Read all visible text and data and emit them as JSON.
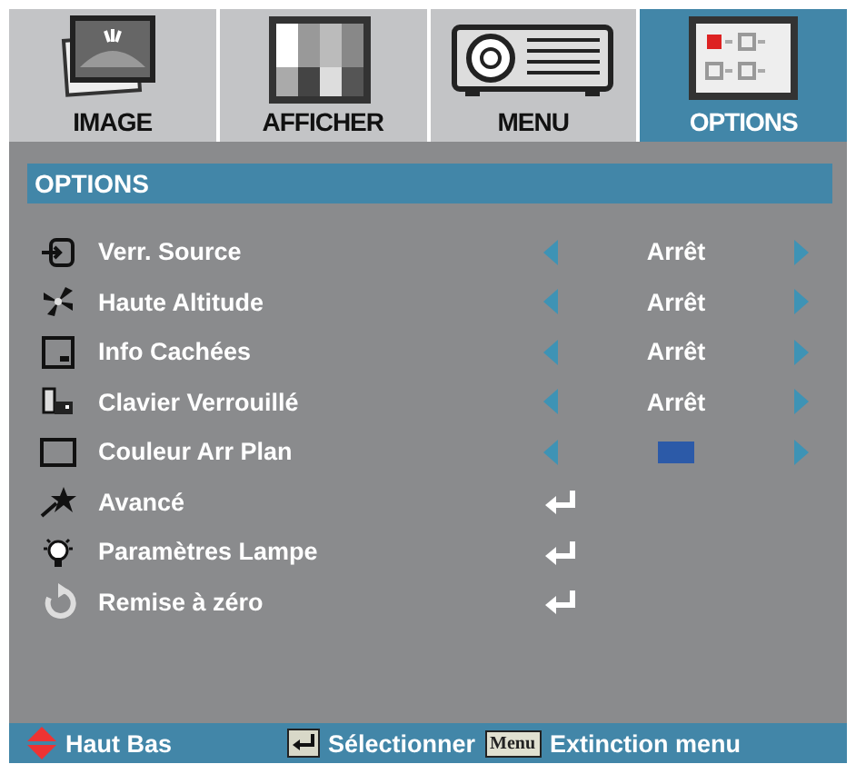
{
  "tabs": [
    {
      "label": "IMAGE",
      "selected": false
    },
    {
      "label": "AFFICHER",
      "selected": false
    },
    {
      "label": "MENU",
      "selected": false
    },
    {
      "label": "OPTIONS",
      "selected": true
    }
  ],
  "section_title": "OPTIONS",
  "rows": [
    {
      "kind": "option",
      "label": "Verr. Source",
      "value": "Arrêt"
    },
    {
      "kind": "option",
      "label": "Haute Altitude",
      "value": "Arrêt"
    },
    {
      "kind": "option",
      "label": "Info Cachées",
      "value": "Arrêt"
    },
    {
      "kind": "option",
      "label": "Clavier Verrouillé",
      "value": "Arrêt"
    },
    {
      "kind": "color",
      "label": "Couleur Arr Plan",
      "color": "#2c5aa8"
    },
    {
      "kind": "submenu",
      "label": "Avancé"
    },
    {
      "kind": "submenu",
      "label": "Paramètres Lampe"
    },
    {
      "kind": "submenu",
      "label": "Remise à zéro"
    }
  ],
  "footer": {
    "navigate": "Haut Bas",
    "select": "Sélectionner",
    "menu_key": "Menu",
    "exit": "Extinction menu"
  }
}
